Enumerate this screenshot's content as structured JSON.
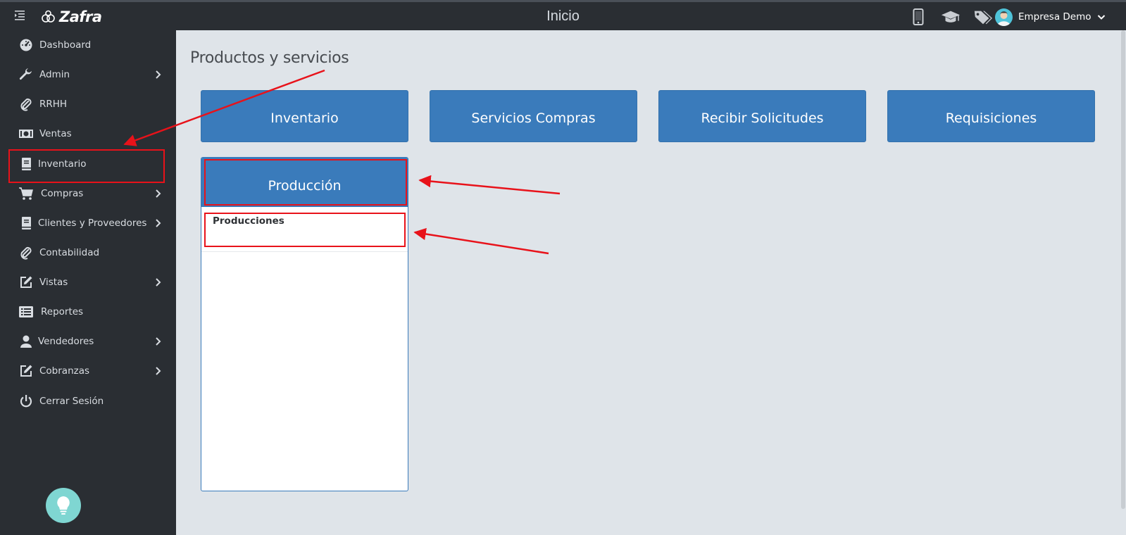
{
  "header": {
    "brand": "Zafra",
    "title": "Inicio",
    "user_name": "Empresa Demo",
    "icons": [
      "mobile-icon",
      "graduation-cap-icon",
      "tags-icon",
      "avatar",
      "chevron-down-icon"
    ]
  },
  "sidebar": {
    "items": [
      {
        "label": "Dashboard",
        "icon": "dashboard-icon",
        "has_submenu": false
      },
      {
        "label": "Admin",
        "icon": "wrench-icon",
        "has_submenu": true
      },
      {
        "label": "RRHH",
        "icon": "paperclip-icon",
        "has_submenu": false
      },
      {
        "label": "Ventas",
        "icon": "money-icon",
        "has_submenu": false
      },
      {
        "label": "Inventario",
        "icon": "book-icon",
        "has_submenu": false
      },
      {
        "label": "Compras",
        "icon": "cart-icon",
        "has_submenu": true
      },
      {
        "label": "Clientes y Proveedores",
        "icon": "book-icon",
        "has_submenu": true
      },
      {
        "label": "Contabilidad",
        "icon": "paperclip-icon",
        "has_submenu": false
      },
      {
        "label": "Vistas",
        "icon": "edit-icon",
        "has_submenu": true
      },
      {
        "label": "Reportes",
        "icon": "list-icon",
        "has_submenu": false
      },
      {
        "label": "Vendedores",
        "icon": "user-icon",
        "has_submenu": true
      },
      {
        "label": "Cobranzas",
        "icon": "edit-icon",
        "has_submenu": true
      },
      {
        "label": "Cerrar Sesión",
        "icon": "power-icon",
        "has_submenu": false
      }
    ],
    "help_icon": "lightbulb-icon"
  },
  "main": {
    "title": "Productos y servicios",
    "tiles": [
      "Inventario",
      "Servicios Compras",
      "Recibir Solicitudes",
      "Requisiciones"
    ],
    "panel": {
      "title": "Producción",
      "links": [
        "Producciones"
      ]
    }
  },
  "colors": {
    "sidebar_bg": "#2a2e33",
    "content_bg": "#dfe4e9",
    "tile_blue": "#3a7bbb",
    "annotation_red": "#e8121a"
  }
}
